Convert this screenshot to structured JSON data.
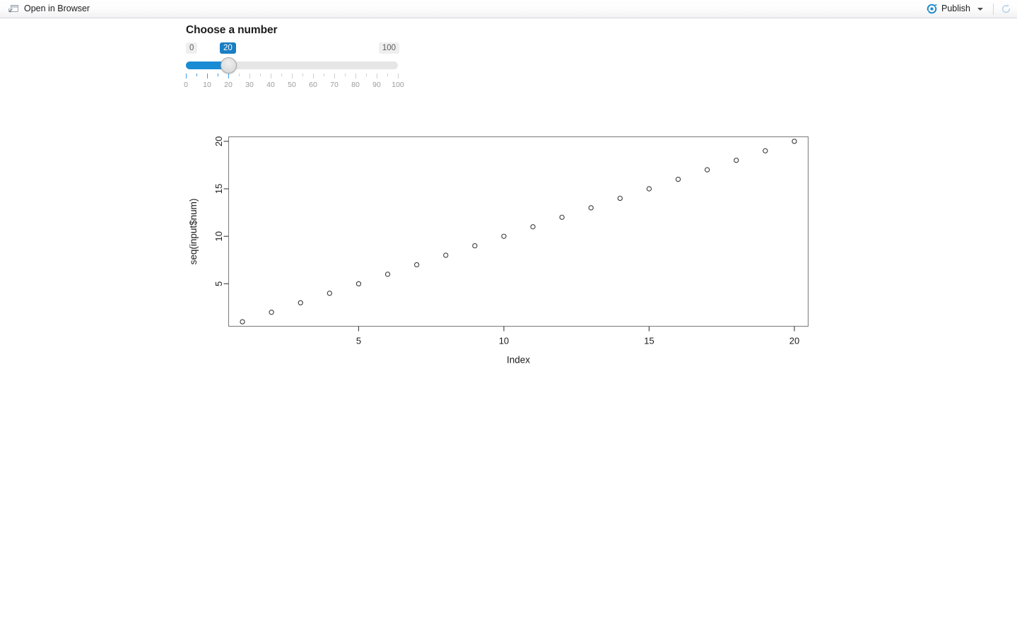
{
  "toolbar": {
    "open_in_browser_label": "Open in Browser",
    "open_in_browser_icon": "open-in-browser-icon",
    "publish_label": "Publish",
    "publish_icon": "publish-icon",
    "publish_dropdown_icon": "chevron-down-icon",
    "refresh_icon": "refresh-icon"
  },
  "app": {
    "panel_title": "Choose a number",
    "slider": {
      "min_label": "0",
      "max_label": "100",
      "value_label": "20",
      "min": 0,
      "max": 100,
      "value": 20,
      "step": 5,
      "tick_positions": [
        0,
        5,
        10,
        15,
        20,
        25,
        30,
        35,
        40,
        45,
        50,
        55,
        60,
        65,
        70,
        75,
        80,
        85,
        90,
        95,
        100
      ],
      "major_ticks": [
        0,
        10,
        20,
        30,
        40,
        50,
        60,
        70,
        80,
        90,
        100
      ],
      "tick_labels": [
        "0",
        "10",
        "20",
        "30",
        "40",
        "50",
        "60",
        "70",
        "80",
        "90",
        "100"
      ],
      "fill_color": "#1a8cd5",
      "value_pill_color": "#1a7ec2",
      "track_color": "#e6e6e6"
    }
  },
  "chart_data": {
    "type": "scatter",
    "title": "",
    "xlabel": "Index",
    "ylabel": "seq(input$num)",
    "x": [
      1,
      2,
      3,
      4,
      5,
      6,
      7,
      8,
      9,
      10,
      11,
      12,
      13,
      14,
      15,
      16,
      17,
      18,
      19,
      20
    ],
    "y": [
      1,
      2,
      3,
      4,
      5,
      6,
      7,
      8,
      9,
      10,
      11,
      12,
      13,
      14,
      15,
      16,
      17,
      18,
      19,
      20
    ],
    "xlim": [
      0.525,
      20.475
    ],
    "ylim": [
      0.525,
      20.475
    ],
    "xticks": [
      5,
      10,
      15,
      20
    ],
    "xtick_labels": [
      "5",
      "10",
      "15",
      "20"
    ],
    "yticks": [
      5,
      10,
      15,
      20
    ],
    "ytick_labels": [
      "5",
      "10",
      "15",
      "20"
    ],
    "grid": false,
    "legend": false,
    "marker": "open-circle",
    "marker_color": "#3c3c3c",
    "box_color": "#808080"
  }
}
